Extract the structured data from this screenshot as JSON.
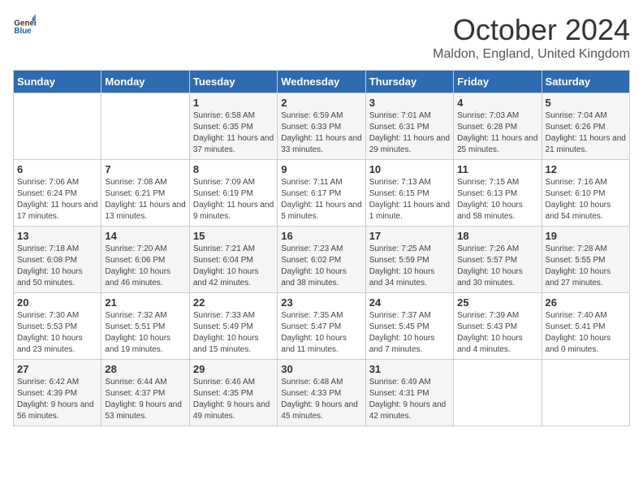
{
  "header": {
    "logo_general": "General",
    "logo_blue": "Blue",
    "month": "October 2024",
    "location": "Maldon, England, United Kingdom"
  },
  "weekdays": [
    "Sunday",
    "Monday",
    "Tuesday",
    "Wednesday",
    "Thursday",
    "Friday",
    "Saturday"
  ],
  "weeks": [
    [
      {
        "day": "",
        "sunrise": "",
        "sunset": "",
        "daylight": ""
      },
      {
        "day": "",
        "sunrise": "",
        "sunset": "",
        "daylight": ""
      },
      {
        "day": "1",
        "sunrise": "Sunrise: 6:58 AM",
        "sunset": "Sunset: 6:35 PM",
        "daylight": "Daylight: 11 hours and 37 minutes."
      },
      {
        "day": "2",
        "sunrise": "Sunrise: 6:59 AM",
        "sunset": "Sunset: 6:33 PM",
        "daylight": "Daylight: 11 hours and 33 minutes."
      },
      {
        "day": "3",
        "sunrise": "Sunrise: 7:01 AM",
        "sunset": "Sunset: 6:31 PM",
        "daylight": "Daylight: 11 hours and 29 minutes."
      },
      {
        "day": "4",
        "sunrise": "Sunrise: 7:03 AM",
        "sunset": "Sunset: 6:28 PM",
        "daylight": "Daylight: 11 hours and 25 minutes."
      },
      {
        "day": "5",
        "sunrise": "Sunrise: 7:04 AM",
        "sunset": "Sunset: 6:26 PM",
        "daylight": "Daylight: 11 hours and 21 minutes."
      }
    ],
    [
      {
        "day": "6",
        "sunrise": "Sunrise: 7:06 AM",
        "sunset": "Sunset: 6:24 PM",
        "daylight": "Daylight: 11 hours and 17 minutes."
      },
      {
        "day": "7",
        "sunrise": "Sunrise: 7:08 AM",
        "sunset": "Sunset: 6:21 PM",
        "daylight": "Daylight: 11 hours and 13 minutes."
      },
      {
        "day": "8",
        "sunrise": "Sunrise: 7:09 AM",
        "sunset": "Sunset: 6:19 PM",
        "daylight": "Daylight: 11 hours and 9 minutes."
      },
      {
        "day": "9",
        "sunrise": "Sunrise: 7:11 AM",
        "sunset": "Sunset: 6:17 PM",
        "daylight": "Daylight: 11 hours and 5 minutes."
      },
      {
        "day": "10",
        "sunrise": "Sunrise: 7:13 AM",
        "sunset": "Sunset: 6:15 PM",
        "daylight": "Daylight: 11 hours and 1 minute."
      },
      {
        "day": "11",
        "sunrise": "Sunrise: 7:15 AM",
        "sunset": "Sunset: 6:13 PM",
        "daylight": "Daylight: 10 hours and 58 minutes."
      },
      {
        "day": "12",
        "sunrise": "Sunrise: 7:16 AM",
        "sunset": "Sunset: 6:10 PM",
        "daylight": "Daylight: 10 hours and 54 minutes."
      }
    ],
    [
      {
        "day": "13",
        "sunrise": "Sunrise: 7:18 AM",
        "sunset": "Sunset: 6:08 PM",
        "daylight": "Daylight: 10 hours and 50 minutes."
      },
      {
        "day": "14",
        "sunrise": "Sunrise: 7:20 AM",
        "sunset": "Sunset: 6:06 PM",
        "daylight": "Daylight: 10 hours and 46 minutes."
      },
      {
        "day": "15",
        "sunrise": "Sunrise: 7:21 AM",
        "sunset": "Sunset: 6:04 PM",
        "daylight": "Daylight: 10 hours and 42 minutes."
      },
      {
        "day": "16",
        "sunrise": "Sunrise: 7:23 AM",
        "sunset": "Sunset: 6:02 PM",
        "daylight": "Daylight: 10 hours and 38 minutes."
      },
      {
        "day": "17",
        "sunrise": "Sunrise: 7:25 AM",
        "sunset": "Sunset: 5:59 PM",
        "daylight": "Daylight: 10 hours and 34 minutes."
      },
      {
        "day": "18",
        "sunrise": "Sunrise: 7:26 AM",
        "sunset": "Sunset: 5:57 PM",
        "daylight": "Daylight: 10 hours and 30 minutes."
      },
      {
        "day": "19",
        "sunrise": "Sunrise: 7:28 AM",
        "sunset": "Sunset: 5:55 PM",
        "daylight": "Daylight: 10 hours and 27 minutes."
      }
    ],
    [
      {
        "day": "20",
        "sunrise": "Sunrise: 7:30 AM",
        "sunset": "Sunset: 5:53 PM",
        "daylight": "Daylight: 10 hours and 23 minutes."
      },
      {
        "day": "21",
        "sunrise": "Sunrise: 7:32 AM",
        "sunset": "Sunset: 5:51 PM",
        "daylight": "Daylight: 10 hours and 19 minutes."
      },
      {
        "day": "22",
        "sunrise": "Sunrise: 7:33 AM",
        "sunset": "Sunset: 5:49 PM",
        "daylight": "Daylight: 10 hours and 15 minutes."
      },
      {
        "day": "23",
        "sunrise": "Sunrise: 7:35 AM",
        "sunset": "Sunset: 5:47 PM",
        "daylight": "Daylight: 10 hours and 11 minutes."
      },
      {
        "day": "24",
        "sunrise": "Sunrise: 7:37 AM",
        "sunset": "Sunset: 5:45 PM",
        "daylight": "Daylight: 10 hours and 7 minutes."
      },
      {
        "day": "25",
        "sunrise": "Sunrise: 7:39 AM",
        "sunset": "Sunset: 5:43 PM",
        "daylight": "Daylight: 10 hours and 4 minutes."
      },
      {
        "day": "26",
        "sunrise": "Sunrise: 7:40 AM",
        "sunset": "Sunset: 5:41 PM",
        "daylight": "Daylight: 10 hours and 0 minutes."
      }
    ],
    [
      {
        "day": "27",
        "sunrise": "Sunrise: 6:42 AM",
        "sunset": "Sunset: 4:39 PM",
        "daylight": "Daylight: 9 hours and 56 minutes."
      },
      {
        "day": "28",
        "sunrise": "Sunrise: 6:44 AM",
        "sunset": "Sunset: 4:37 PM",
        "daylight": "Daylight: 9 hours and 53 minutes."
      },
      {
        "day": "29",
        "sunrise": "Sunrise: 6:46 AM",
        "sunset": "Sunset: 4:35 PM",
        "daylight": "Daylight: 9 hours and 49 minutes."
      },
      {
        "day": "30",
        "sunrise": "Sunrise: 6:48 AM",
        "sunset": "Sunset: 4:33 PM",
        "daylight": "Daylight: 9 hours and 45 minutes."
      },
      {
        "day": "31",
        "sunrise": "Sunrise: 6:49 AM",
        "sunset": "Sunset: 4:31 PM",
        "daylight": "Daylight: 9 hours and 42 minutes."
      },
      {
        "day": "",
        "sunrise": "",
        "sunset": "",
        "daylight": ""
      },
      {
        "day": "",
        "sunrise": "",
        "sunset": "",
        "daylight": ""
      }
    ]
  ]
}
